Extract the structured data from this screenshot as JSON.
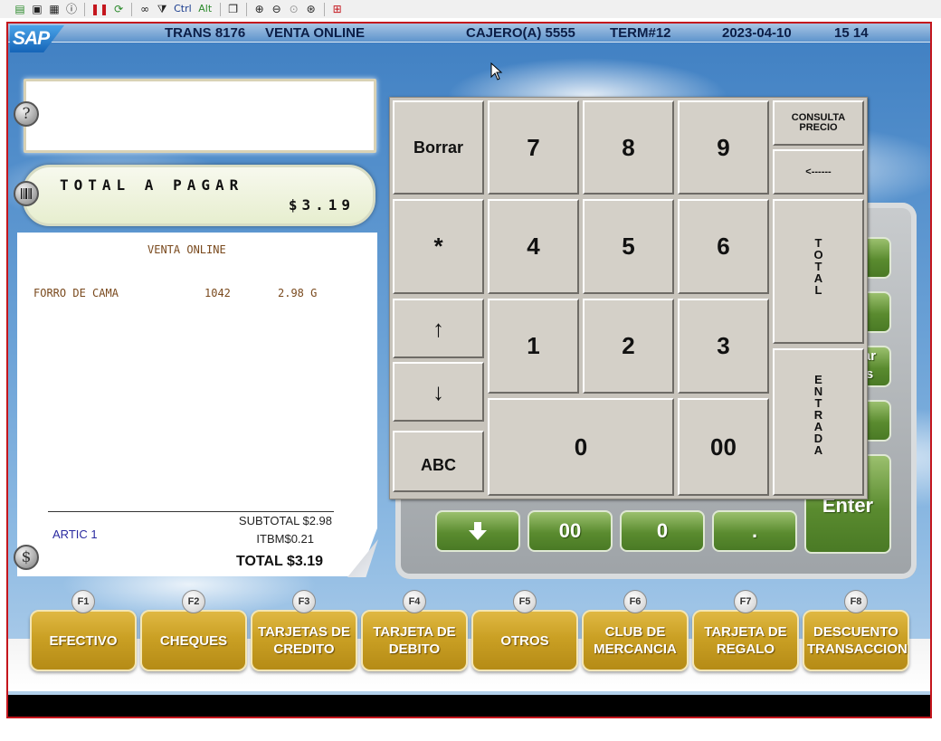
{
  "toolbar": {
    "buttons": [
      "new-icon",
      "save-icon",
      "properties-icon",
      "info-icon",
      "pause-icon",
      "refresh-icon",
      "binoculars-icon",
      "filter-icon"
    ],
    "ctrl_label": "Ctrl",
    "alt_label": "Alt"
  },
  "status": {
    "trans": "TRANS 8176",
    "channel": "VENTA ONLINE",
    "cashier": "CAJERO(A) 5555",
    "terminal": "TERM#12",
    "date": "2023-04-10",
    "time": "15 14"
  },
  "logo_text": "SAP",
  "help_icon": "?",
  "dollar_icon": "$",
  "total": {
    "label": "TOTAL A PAGAR",
    "amount": "$3.19"
  },
  "receipt": {
    "header": "VENTA ONLINE",
    "items": [
      {
        "description": "FORRO DE CAMA",
        "code": "1042",
        "price": "2.98 G"
      }
    ],
    "artic_count": "ARTIC 1",
    "subtotal": "SUBTOTAL $2.98",
    "tax": "ITBM$0.21",
    "total": "TOTAL $3.19"
  },
  "keypad": {
    "borrar": "Borrar",
    "k7": "7",
    "k8": "8",
    "k9": "9",
    "consulta_line1": "CONSULTA",
    "consulta_line2": "PRECIO",
    "backspace": "<------",
    "star": "*",
    "k4": "4",
    "k5": "5",
    "k6": "6",
    "total_vertical": [
      "T",
      "O",
      "T",
      "A",
      "L"
    ],
    "up": "↑",
    "down": "↓",
    "k1": "1",
    "k2": "2",
    "k3": "3",
    "abc": "ABC",
    "k0": "0",
    "k00": "00",
    "entrada_vertical": [
      "E",
      "N",
      "T",
      "R",
      "A",
      "D",
      "A"
    ]
  },
  "background_keypad": {
    "enter_label": "Enter",
    "down_arrow": "🡇",
    "double_zero": "00",
    "zero": "0",
    "dot": ".",
    "partial_ar": "ar",
    "partial_s": "s"
  },
  "function_keys": [
    {
      "badge": "F1",
      "label": "EFECTIVO"
    },
    {
      "badge": "F2",
      "label": "CHEQUES"
    },
    {
      "badge": "F3",
      "label": "TARJETAS DE CREDITO"
    },
    {
      "badge": "F4",
      "label": "TARJETA DE DEBITO"
    },
    {
      "badge": "F5",
      "label": "OTROS"
    },
    {
      "badge": "F6",
      "label": "CLUB DE MERCANCIA"
    },
    {
      "badge": "F7",
      "label": "TARJETA DE REGALO"
    },
    {
      "badge": "F8",
      "label": "DESCUENTO TRANSACCION"
    }
  ],
  "colors": {
    "frame_border": "#c4151c",
    "fkey_gold": "#caa024",
    "keypad_gray": "#d4d0c8",
    "green_key": "#5a8b2f",
    "receipt_text": "#7a4a1e",
    "receipt_footer_text": "#2a2aa0"
  }
}
